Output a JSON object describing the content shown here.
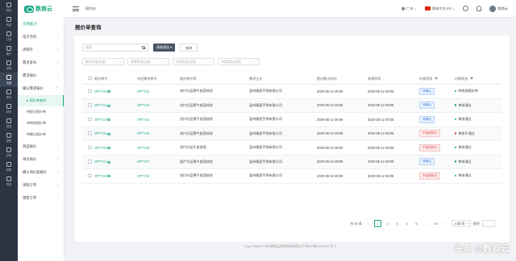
{
  "brand": {
    "name": "数商云"
  },
  "rail": [
    {
      "label": "首页"
    },
    {
      "label": "商品"
    },
    {
      "label": "订单"
    },
    {
      "label": "客户"
    },
    {
      "label": "采购"
    },
    {
      "label": "交易"
    },
    {
      "label": "库存"
    },
    {
      "label": "财务"
    },
    {
      "label": "营销"
    },
    {
      "label": "报表"
    },
    {
      "label": "应用"
    },
    {
      "label": "权限"
    },
    {
      "label": "系统"
    }
  ],
  "subnav": {
    "title": "交易能力",
    "items": [
      {
        "label": "电子合同"
      },
      {
        "label": "进销存"
      },
      {
        "label": "需求发布"
      },
      {
        "label": "需求报价"
      }
    ],
    "open_group": "确认需求报价",
    "children": [
      {
        "label": "报价单查询"
      },
      {
        "label": "待提交报价单"
      },
      {
        "label": "待审核报价单"
      },
      {
        "label": "待确认报价单"
      }
    ],
    "items_after": [
      {
        "label": "商品报价"
      },
      {
        "label": "询价报价"
      },
      {
        "label": "确认询价品报价"
      },
      {
        "label": "采购订单"
      },
      {
        "label": "销售订单"
      }
    ]
  },
  "topbar": {
    "home": "国内站",
    "city": "广州",
    "locale": "简体中文-ZH",
    "user": "数商云"
  },
  "page": {
    "title": "报价单查询"
  },
  "search": {
    "placeholder": "搜索",
    "advanced_label": "高级筛选",
    "reset_label": "查询"
  },
  "filters": [
    {
      "placeholder": "报价状态(全部)"
    },
    {
      "placeholder": "来源状态(全部)"
    },
    {
      "placeholder": "外部状态(全部)"
    },
    {
      "placeholder": "内部状态(全部)"
    }
  ],
  "table": {
    "headers": [
      "报价单号",
      "对应需求单号",
      "报价单名称",
      "需求企业",
      "报价截止时间",
      "来源时间",
      "外部状态",
      "内部状态"
    ],
    "rows": [
      {
        "quote_no": "SPTY12",
        "demand_no": "SPTY12",
        "name": "进口头层黄牛皮荔枝纹",
        "company": "温州隆昌手袋有限公司",
        "deadline": "2020-05-12 08:08",
        "created": "2020-05-12 08:08",
        "ext_status": "待确认",
        "ext_type": "pending",
        "int_status": "待修改报价单",
        "int_color": "#1ba784"
      },
      {
        "quote_no": "SPTY13",
        "demand_no": "SPTY13",
        "name": "进口头层黄牛皮荔枝纹",
        "company": "温州隆昌手袋有限公司",
        "deadline": "2020-05-12 08:08",
        "created": "2020-05-12 08:08",
        "ext_status": "待确认",
        "ext_type": "pending",
        "int_status": "审核通过",
        "int_color": "#1ba784"
      },
      {
        "quote_no": "SPTY14",
        "demand_no": "SPTY14",
        "name": "进口头层黄牛皮荔枝纹",
        "company": "温州隆昌手袋有限公司",
        "deadline": "2020-05-12 08:08",
        "created": "2020-05-12 08:08",
        "ext_status": "待确认",
        "ext_type": "pending",
        "int_status": "审核通过",
        "int_color": "#1ba784"
      },
      {
        "quote_no": "SPTY15",
        "demand_no": "SPTY15",
        "name": "进口头层黄牛皮荔枝纹",
        "company": "温州隆昌手袋有限公司",
        "deadline": "2020-05-12 08:08",
        "created": "2020-05-12 08:08",
        "ext_status": "不接受报价",
        "ext_type": "bad",
        "int_status": "审核不通过",
        "int_color": "#e05050"
      },
      {
        "quote_no": "SPTY16",
        "demand_no": "SPTY16",
        "name": "进口头层牛皮漆面",
        "company": "温州隆昌手袋有限公司",
        "deadline": "2020-05-12 08:08",
        "created": "2020-05-12 08:08",
        "ext_status": "不接受报价",
        "ext_type": "bad",
        "int_status": "审核通过",
        "int_color": "#1ba784"
      },
      {
        "quote_no": "SPTY17",
        "demand_no": "SPTY17",
        "name": "国产头层黄牛皮荔枝纹",
        "company": "温州隆昌手袋有限公司",
        "deadline": "2020-05-12 08:08",
        "created": "2020-05-12 08:08",
        "ext_status": "待确认",
        "ext_type": "pending",
        "int_status": "审核通过",
        "int_color": "#1ba784"
      },
      {
        "quote_no": "SPTY18",
        "demand_no": "SPTY18",
        "name": "进口头层黄牛皮荔枝纹",
        "company": "温州隆昌手袋有限公司",
        "deadline": "2020-05-12 08:08",
        "created": "2020-05-12 08:08",
        "ext_status": "不接受报价",
        "ext_type": "bad",
        "int_status": "审核通过",
        "int_color": "#1ba784"
      }
    ]
  },
  "pagination": {
    "total": "共 80 条",
    "pages": [
      "1",
      "2",
      "3",
      "4",
      "5",
      "…",
      "10"
    ],
    "current": "1",
    "page_size": "10条/页",
    "goto_label": "前往"
  },
  "footer": "Copy Right©广州市数商云网络科技有限公司 粤ICP备13044717号-5",
  "watermark": "头条 @数商云",
  "colors": {
    "accent": "#1ba784",
    "sidebar": "#2b3441",
    "danger": "#e05050",
    "info": "#3d7fe0"
  }
}
